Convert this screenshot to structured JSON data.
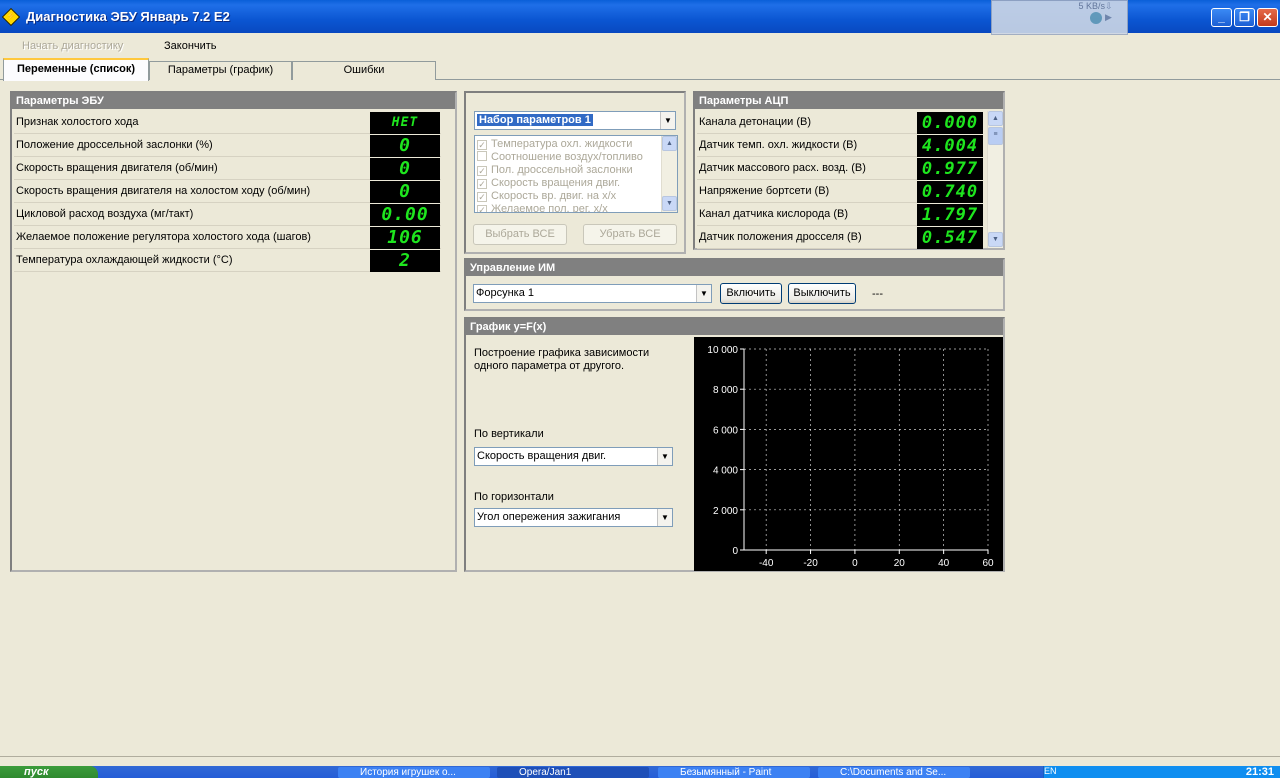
{
  "window": {
    "title": "Диагностика ЭБУ Январь 7.2 E2",
    "net_rate": "5 KB/s"
  },
  "menu": {
    "start_diag": "Начать диагностику",
    "finish": "Закончить"
  },
  "tabs": [
    {
      "label": "Переменные (список)",
      "active": true
    },
    {
      "label": "Параметры (график)",
      "active": false
    },
    {
      "label": "Ошибки",
      "active": false
    }
  ],
  "ecu_params": {
    "header": "Параметры ЭБУ",
    "rows": [
      {
        "label": "Признак холостого хода",
        "value": "НЕТ"
      },
      {
        "label": "Положение дроссельной заслонки (%)",
        "value": "0"
      },
      {
        "label": "Скорость вращения двигателя (об/мин)",
        "value": "0"
      },
      {
        "label": "Скорость вращения двигателя на холостом ходу (об/мин)",
        "value": "0"
      },
      {
        "label": "Цикловой расход воздуха (мг/такт)",
        "value": "0.00"
      },
      {
        "label": "Желаемое положение регулятора холостого хода (шагов)",
        "value": "106"
      },
      {
        "label": "Температура охлаждающей жидкости (°C)",
        "value": "2"
      }
    ]
  },
  "param_set": {
    "selected": "Набор параметров 1",
    "items": [
      {
        "label": "Температура охл. жидкости",
        "checked": true
      },
      {
        "label": "Соотношение воздух/топливо",
        "checked": false
      },
      {
        "label": "Пол. дроссельной заслонки",
        "checked": true
      },
      {
        "label": "Скорость вращения двиг.",
        "checked": true
      },
      {
        "label": "Скорость вр. двиг. на х/х",
        "checked": true
      },
      {
        "label": "Желаемое пол. рег. х/х",
        "checked": true
      }
    ],
    "select_all": "Выбрать ВСЕ",
    "clear_all": "Убрать ВСЕ"
  },
  "adc": {
    "header": "Параметры АЦП",
    "rows": [
      {
        "label": "Канала детонации (В)",
        "value": "0.000"
      },
      {
        "label": "Датчик темп. охл. жидкости (В)",
        "value": "4.004"
      },
      {
        "label": "Датчик массового расх. возд. (В)",
        "value": "0.977"
      },
      {
        "label": "Напряжение бортсети (В)",
        "value": "0.740"
      },
      {
        "label": "Канал датчика кислорода (В)",
        "value": "1.797"
      },
      {
        "label": "Датчик положения дросселя (В)",
        "value": "0.547"
      }
    ]
  },
  "actuator": {
    "header": "Управление ИМ",
    "selected": "Форсунка 1",
    "on": "Включить",
    "off": "Выключить",
    "status": "---"
  },
  "graph": {
    "header": "График y=F(x)",
    "description": "Построение графика зависимости одного параметра от другого.",
    "vertical_label": "По вертикали",
    "vertical_value": "Скорость вращения двиг.",
    "horizontal_label": "По горизонтали",
    "horizontal_value": "Угол опережения зажигания"
  },
  "chart_data": {
    "type": "scatter",
    "x": [],
    "y": [],
    "xlim": [
      -50,
      60
    ],
    "ylim": [
      0,
      10000
    ],
    "xticks": [
      "-40",
      "-20",
      "0",
      "20",
      "40",
      "60"
    ],
    "yticks": [
      "0",
      "2 000",
      "4 000",
      "6 000",
      "8 000",
      "10 000"
    ],
    "grid": true,
    "colors": {
      "background": "#000000",
      "axis": "#ffffff",
      "grid": "#ffffff"
    }
  },
  "taskbar": {
    "start": "пуск",
    "items": [
      {
        "label": "История игрушек о...",
        "active": false
      },
      {
        "label": "Opera/Jan1",
        "active": true
      },
      {
        "label": "Безымянный - Paint",
        "active": false
      },
      {
        "label": "C:\\Documents and Se...",
        "active": false
      }
    ],
    "lang": "EN",
    "clock": "21:31"
  },
  "colors": {
    "lcd_text": "#1ee61e",
    "lcd_bg": "#000000",
    "panel_header": "#808080",
    "title_bar": "#0b56d2"
  }
}
